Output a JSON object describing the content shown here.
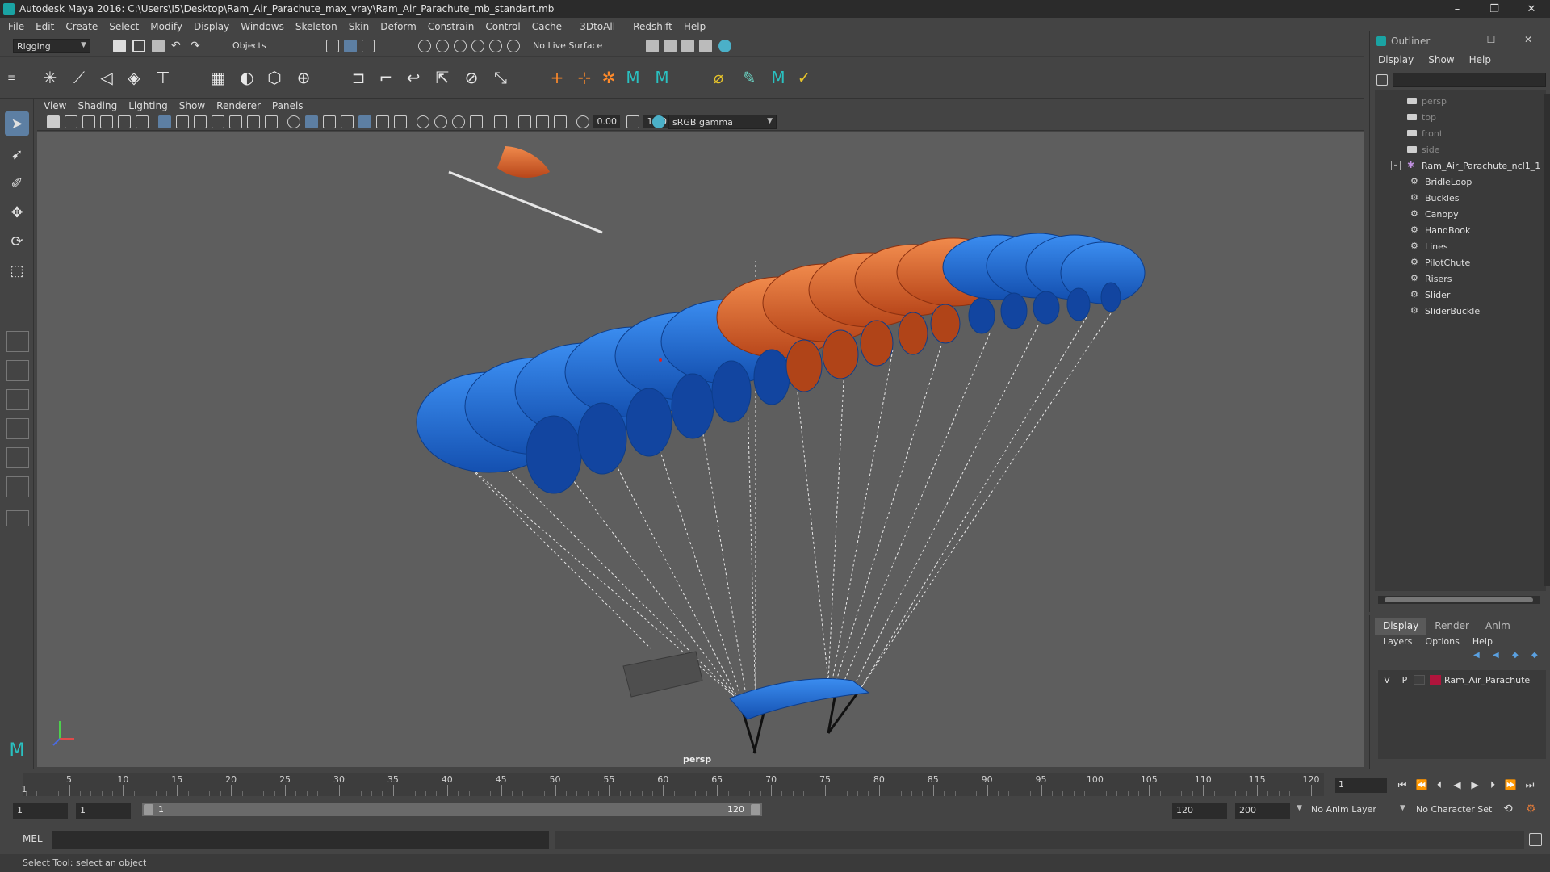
{
  "window": {
    "title": "Autodesk Maya 2016: C:\\Users\\I5\\Desktop\\Ram_Air_Parachute_max_vray\\Ram_Air_Parachute_mb_standart.mb",
    "min": "–",
    "restore": "❐",
    "close": "✕"
  },
  "menubar": [
    "File",
    "Edit",
    "Create",
    "Select",
    "Modify",
    "Display",
    "Windows",
    "Skeleton",
    "Skin",
    "Deform",
    "Constrain",
    "Control",
    "Cache",
    "- 3DtoAll -",
    "Redshift",
    "Help"
  ],
  "statusline": {
    "mode": "Rigging",
    "select_mode": "Objects",
    "live_surface": "No Live Surface"
  },
  "viewport": {
    "menu": [
      "View",
      "Shading",
      "Lighting",
      "Show",
      "Renderer",
      "Panels"
    ],
    "exposure": "0.00",
    "gamma": "1.00",
    "color_space": "sRGB gamma",
    "camera": "persp"
  },
  "outliner": {
    "title": "Outliner",
    "min": "–",
    "max": "☐",
    "close": "✕",
    "menu": [
      "Display",
      "Show",
      "Help"
    ],
    "cameras": [
      "persp",
      "top",
      "front",
      "side"
    ],
    "root": "Ram_Air_Parachute_ncl1_1",
    "children": [
      "BridleLoop",
      "Buckles",
      "Canopy",
      "HandBook",
      "Lines",
      "PilotChute",
      "Risers",
      "Slider",
      "SliderBuckle"
    ]
  },
  "layers": {
    "tabs": [
      "Display",
      "Render",
      "Anim"
    ],
    "menu": [
      "Layers",
      "Options",
      "Help"
    ],
    "row": {
      "v": "V",
      "p": "P",
      "name": "Ram_Air_Parachute",
      "color": "#b0143c"
    }
  },
  "timeline": {
    "ticks": [
      "5",
      "10",
      "15",
      "20",
      "25",
      "30",
      "35",
      "40",
      "45",
      "50",
      "55",
      "60",
      "65",
      "70",
      "75",
      "80",
      "85",
      "90",
      "95",
      "100",
      "105",
      "110",
      "115",
      "120"
    ],
    "start_frame": "1",
    "current_frame": "1"
  },
  "range": {
    "start": "1",
    "start2": "1",
    "bar_start": "1",
    "bar_end": "120",
    "end": "120",
    "end2": "200",
    "anim_layer": "No Anim Layer",
    "char_set": "No Character Set"
  },
  "command": {
    "lang": "MEL"
  },
  "helpline": {
    "text": "Select Tool: select an object"
  },
  "colors": {
    "canopy_blue": "#1f6fd6",
    "canopy_orange": "#e2692b",
    "accent": "#5d7fa3"
  }
}
